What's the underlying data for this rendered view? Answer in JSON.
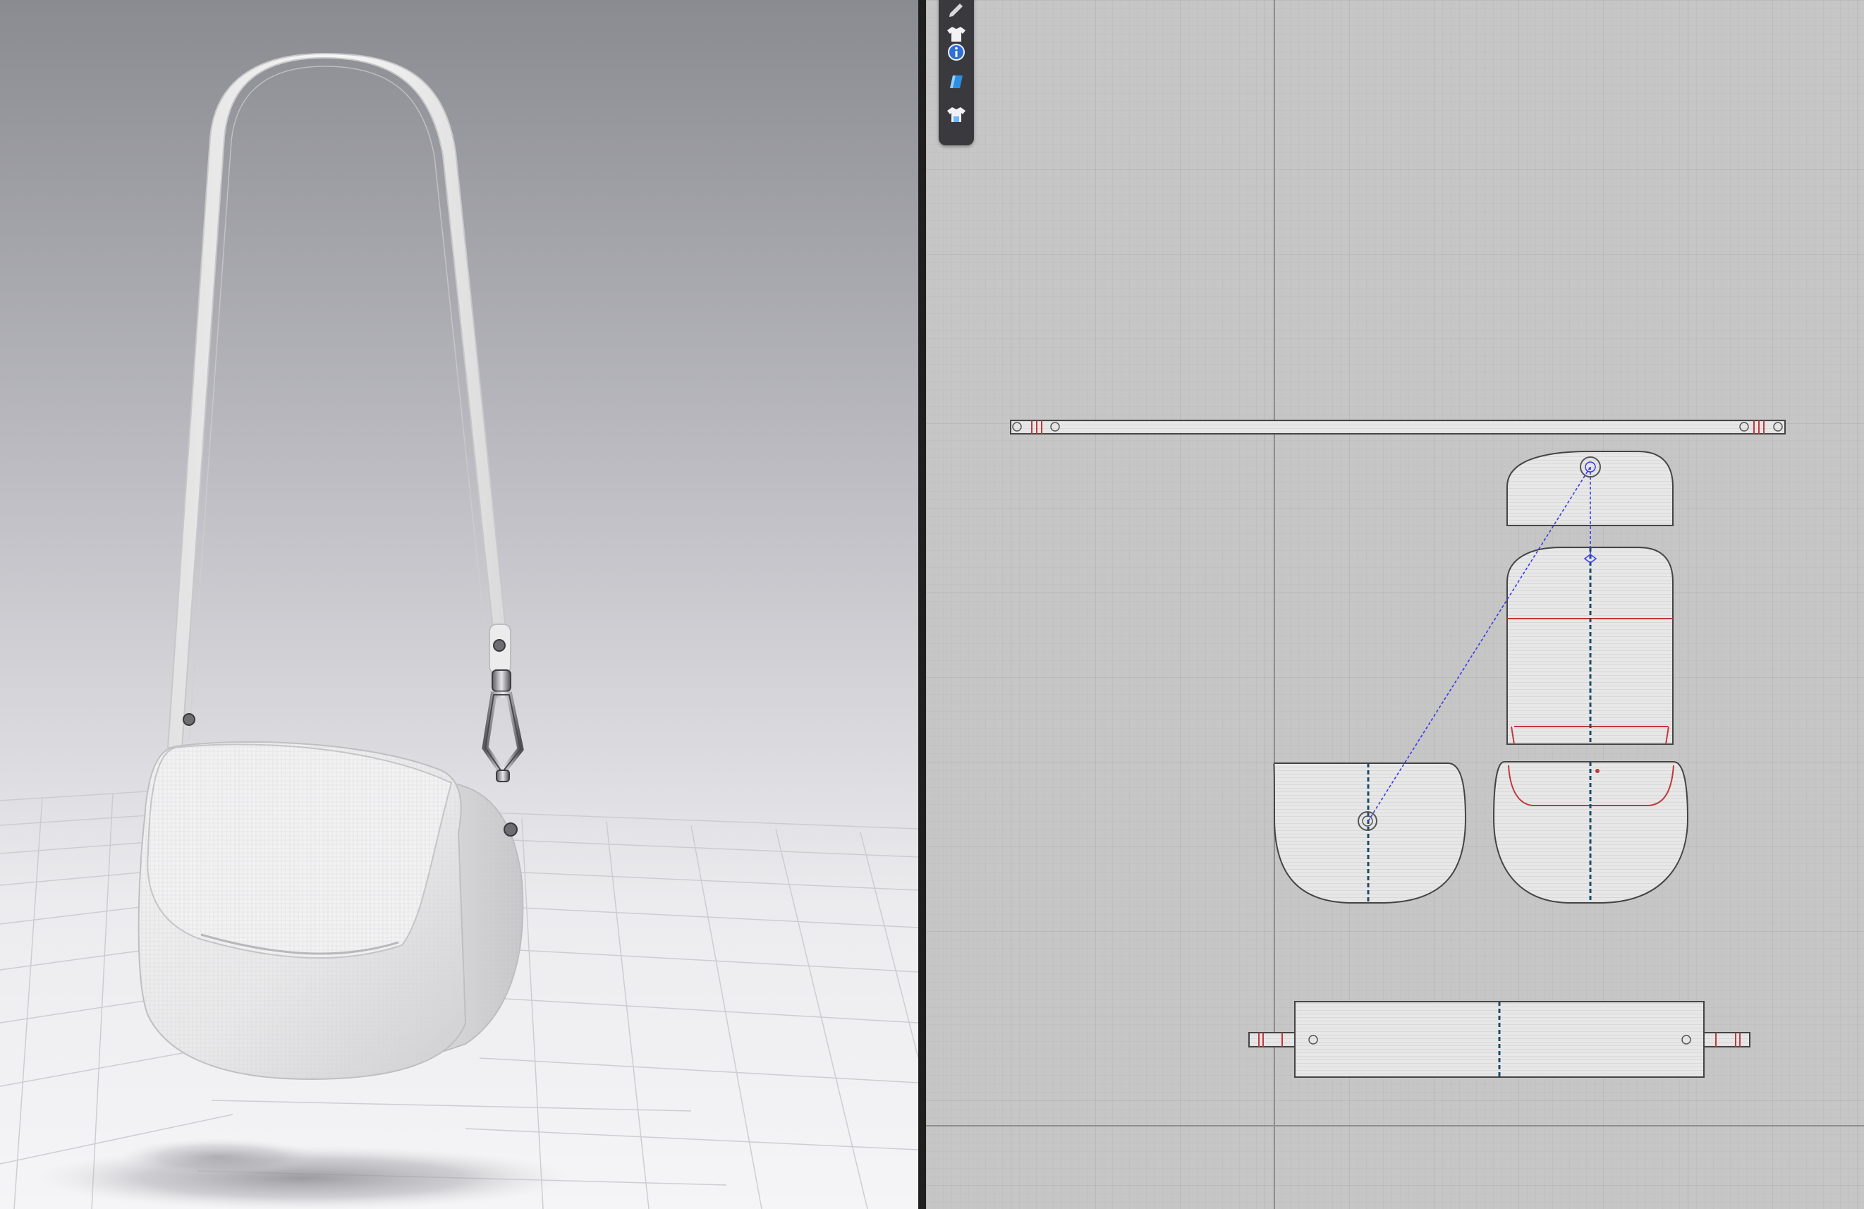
{
  "app": {
    "layout": "split-view",
    "panels": [
      "3d-viewport",
      "2d-pattern-window"
    ],
    "colors": {
      "viewport_3d_bg_top": "#8a8b91",
      "viewport_3d_bg_bottom": "#f5f5f7",
      "viewport_2d_bg": "#c6c6c6",
      "fabric": "#ededed",
      "pattern_piece_fill": "#e6e6e6",
      "internal_line_red": "#c0393b",
      "link_line_blue": "#3a3ae6",
      "toolbar_bg": "#3a3a3e"
    }
  },
  "viewport_3d": {
    "object": "crossbody-bag",
    "parts": [
      "shoulder-strap",
      "metal-swivel-clip",
      "rivet",
      "bag-flap",
      "bag-body",
      "floor-grid",
      "drop-shadow"
    ]
  },
  "toolbar_2d": {
    "buttons": [
      {
        "name": "pen-tool-icon"
      },
      {
        "name": "garment-icon"
      },
      {
        "name": "info-icon"
      },
      {
        "name": "fabric-icon"
      },
      {
        "name": "avatar-garment-icon"
      }
    ]
  },
  "pattern_window": {
    "pieces": [
      "long-strap-piece",
      "flap-top-piece",
      "flap-bottom-piece",
      "body-left-piece",
      "body-right-piece",
      "gusset-strip-piece"
    ]
  }
}
